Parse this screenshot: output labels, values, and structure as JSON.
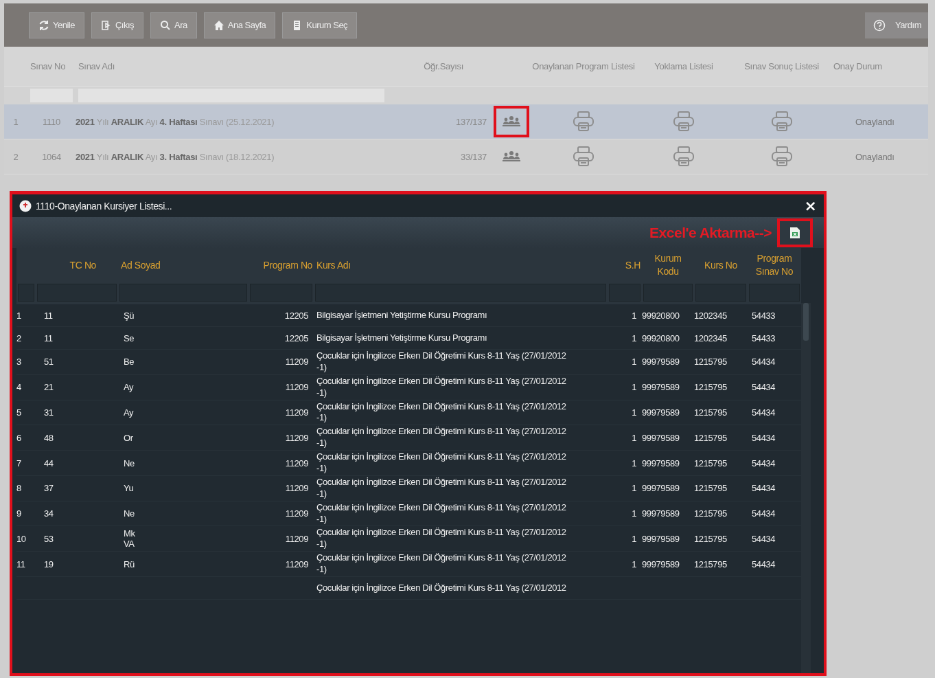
{
  "toolbar": {
    "buttons": [
      {
        "label": "Yenile"
      },
      {
        "label": "Çıkış"
      },
      {
        "label": "Ara"
      },
      {
        "label": "Ana Sayfa"
      },
      {
        "label": "Kurum Seç"
      }
    ],
    "help": {
      "label": "Yardım"
    }
  },
  "exams": {
    "columns": [
      "Sınav No",
      "Sınav Adı",
      "Öğr.Sayısı",
      "Onaylanan Program Listesi",
      "Yoklama Listesi",
      "Sınav Sonuç Listesi",
      "Onay Durum"
    ],
    "rows": [
      {
        "num": "1",
        "no": "1110",
        "name": "**2021** Yılı **ARALIK** Ayı **4. Haftası** Sınavı (25.12.2021)",
        "count": "137/137",
        "status": "Onaylandı",
        "selected": true,
        "annotated": true
      },
      {
        "num": "2",
        "no": "1064",
        "name": "**2021** Yılı **ARALIK** Ayı **3. Haftası** Sınavı (18.12.2021)",
        "count": "33/137",
        "status": "Onaylandı",
        "selected": false,
        "annotated": false
      }
    ]
  },
  "dialog": {
    "title": "1110-Onaylanan Kursiyer Listesi...",
    "close": "×",
    "annotated": true,
    "export_note": "Excel'e Aktarma-->",
    "columns": [
      "TC No",
      "Ad Soyad",
      "Program No",
      "Kurs Adı",
      "S.H",
      "Kurum Kodu",
      "Kurs No",
      "Program Sınav No"
    ],
    "rows": [
      {
        "num": "1",
        "tc": "11",
        "name": "Şü",
        "program_no": "12205",
        "course": "Bilgisayar İşletmeni Yetiştirme Kursu Programı",
        "sh": "1",
        "institution": "99920800",
        "course_no": "1202345",
        "exam_no": "54433"
      },
      {
        "num": "2",
        "tc": "11",
        "name": "Se",
        "program_no": "12205",
        "course": "Bilgisayar İşletmeni Yetiştirme Kursu Programı",
        "sh": "1",
        "institution": "99920800",
        "course_no": "1202345",
        "exam_no": "54433"
      },
      {
        "num": "3",
        "tc": "51",
        "name": "Be",
        "program_no": "11209",
        "course": "Çocuklar için İngilizce Erken Dil Öğretimi Kurs 8-11 Yaş (27/01/2012 -1)",
        "sh": "1",
        "institution": "99979589",
        "course_no": "1215795",
        "exam_no": "54434"
      },
      {
        "num": "4",
        "tc": "21",
        "name": "Ay",
        "program_no": "11209",
        "course": "Çocuklar için İngilizce Erken Dil Öğretimi Kurs 8-11 Yaş (27/01/2012 -1)",
        "sh": "1",
        "institution": "99979589",
        "course_no": "1215795",
        "exam_no": "54434"
      },
      {
        "num": "5",
        "tc": "31",
        "name": "Ay",
        "program_no": "11209",
        "course": "Çocuklar için İngilizce Erken Dil Öğretimi Kurs 8-11 Yaş (27/01/2012 -1)",
        "sh": "1",
        "institution": "99979589",
        "course_no": "1215795",
        "exam_no": "54434"
      },
      {
        "num": "6",
        "tc": "48",
        "name": "Or",
        "program_no": "11209",
        "course": "Çocuklar için İngilizce Erken Dil Öğretimi Kurs 8-11 Yaş (27/01/2012 -1)",
        "sh": "1",
        "institution": "99979589",
        "course_no": "1215795",
        "exam_no": "54434"
      },
      {
        "num": "7",
        "tc": "44",
        "name": "Ne",
        "program_no": "11209",
        "course": "Çocuklar için İngilizce Erken Dil Öğretimi Kurs 8-11 Yaş (27/01/2012 -1)",
        "sh": "1",
        "institution": "99979589",
        "course_no": "1215795",
        "exam_no": "54434"
      },
      {
        "num": "8",
        "tc": "37",
        "name": "Yu",
        "program_no": "11209",
        "course": "Çocuklar için İngilizce Erken Dil Öğretimi Kurs 8-11 Yaş (27/01/2012 -1)",
        "sh": "1",
        "institution": "99979589",
        "course_no": "1215795",
        "exam_no": "54434"
      },
      {
        "num": "9",
        "tc": "34",
        "name": "Ne",
        "program_no": "11209",
        "course": "Çocuklar için İngilizce Erken Dil Öğretimi Kurs 8-11 Yaş (27/01/2012 -1)",
        "sh": "1",
        "institution": "99979589",
        "course_no": "1215795",
        "exam_no": "54434"
      },
      {
        "num": "10",
        "tc": "53",
        "name": "Mk VA",
        "program_no": "11209",
        "course": "Çocuklar için İngilizce Erken Dil Öğretimi Kurs 8-11 Yaş (27/01/2012 -1)",
        "sh": "1",
        "institution": "99979589",
        "course_no": "1215795",
        "exam_no": "54434"
      },
      {
        "num": "11",
        "tc": "19",
        "name": "Rü",
        "program_no": "11209",
        "course": "Çocuklar için İngilizce Erken Dil Öğretimi Kurs 8-11 Yaş (27/01/2012 -1)",
        "sh": "1",
        "institution": "99979589",
        "course_no": "1215795",
        "exam_no": "54434"
      },
      {
        "course": "Çocuklar için İngilizce Erken Dil Öğretimi Kurs 8-11 Yaş (27/01/2012"
      }
    ]
  }
}
